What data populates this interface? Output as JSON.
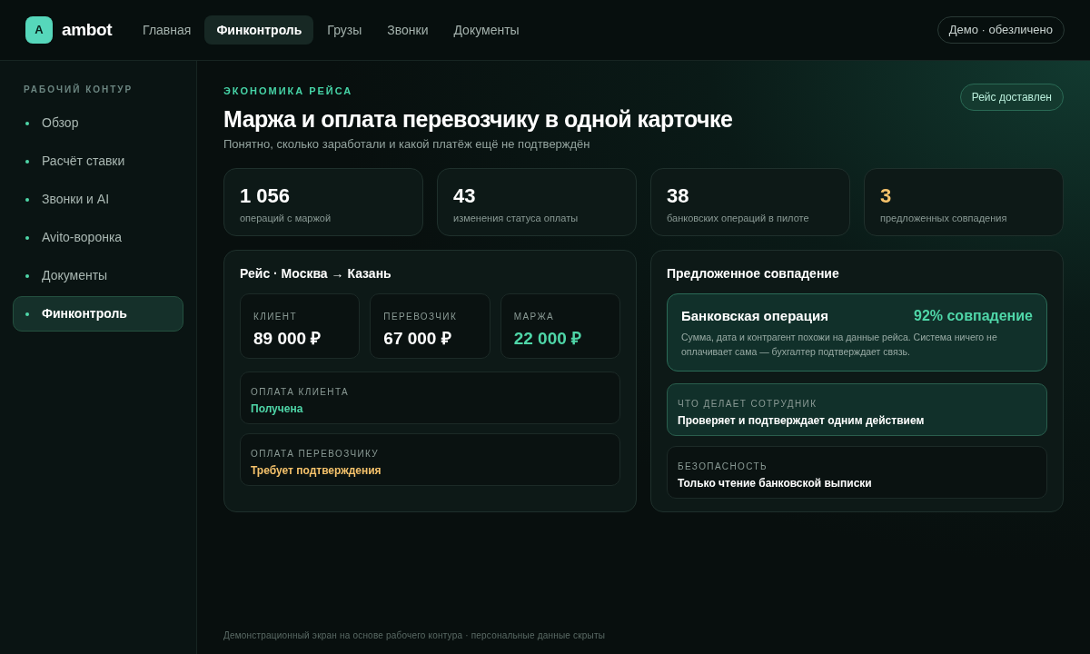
{
  "header": {
    "logo": {
      "mark": "A",
      "name": "ambot"
    },
    "nav": [
      {
        "label": "Главная",
        "selected": false
      },
      {
        "label": "Финконтроль",
        "selected": true
      },
      {
        "label": "Грузы",
        "selected": false
      },
      {
        "label": "Звонки",
        "selected": false
      },
      {
        "label": "Документы",
        "selected": false
      }
    ],
    "mode_chip": "Демо · обезличено"
  },
  "sidebar": {
    "heading": "РАБОЧИЙ КОНТУР",
    "items": [
      {
        "label": "Обзор",
        "selected": false
      },
      {
        "label": "Расчёт ставки",
        "selected": false
      },
      {
        "label": "Звонки и AI",
        "selected": false
      },
      {
        "label": "Avito-воронка",
        "selected": false
      },
      {
        "label": "Документы",
        "selected": false
      },
      {
        "label": "Финконтроль",
        "selected": true
      }
    ]
  },
  "page": {
    "eyebrow": "ЭКОНОМИКА РЕЙСА",
    "title": "Маржа и оплата перевозчику в одной карточке",
    "subtitle": "Понятно, сколько заработали и какой платёж ещё не подтверждён",
    "status_badge": "Рейс доставлен"
  },
  "stats": [
    {
      "value": "1 056",
      "label": "операций с маржой",
      "color": "#ffffff"
    },
    {
      "value": "43",
      "label": "изменения статуса оплаты",
      "color": "#ffffff"
    },
    {
      "value": "38",
      "label": "банковских операций в пилоте",
      "color": "#ffffff"
    },
    {
      "value": "3",
      "label": "предложенных совпадения",
      "color": "#f5c26b"
    }
  ],
  "trip": {
    "title": "Рейс · Москва → Казань",
    "amounts": [
      {
        "label": "КЛИЕНТ",
        "value": "89 000 ₽",
        "color": "#ffffff"
      },
      {
        "label": "ПЕРЕВОЗЧИК",
        "value": "67 000 ₽",
        "color": "#ffffff"
      },
      {
        "label": "МАРЖА",
        "value": "22 000 ₽",
        "color": "#4fd6a8"
      }
    ],
    "payments": [
      {
        "label": "ОПЛАТА КЛИЕНТА",
        "status": "Получена",
        "color": "#4fd6a8"
      },
      {
        "label": "ОПЛАТА ПЕРЕВОЗЧИКУ",
        "status": "Требует подтверждения",
        "color": "#f5c26b"
      }
    ]
  },
  "match": {
    "title": "Предложенное совпадение",
    "operation": {
      "title": "Банковская операция",
      "score": "92% совпадение",
      "description": "Сумма, дата и контрагент похожи на данные рейса. Система ничего не оплачивает сама — бухгалтер подтверждает связь."
    },
    "details": [
      {
        "label": "ЧТО ДЕЛАЕТ СОТРУДНИК",
        "value": "Проверяет и подтверждает одним действием",
        "highlighted": true
      },
      {
        "label": "БЕЗОПАСНОСТЬ",
        "value": "Только чтение банковской выписки",
        "highlighted": false
      }
    ]
  },
  "footer": "Демонстрационный экран на основе рабочего контура · персональные данные скрыты"
}
